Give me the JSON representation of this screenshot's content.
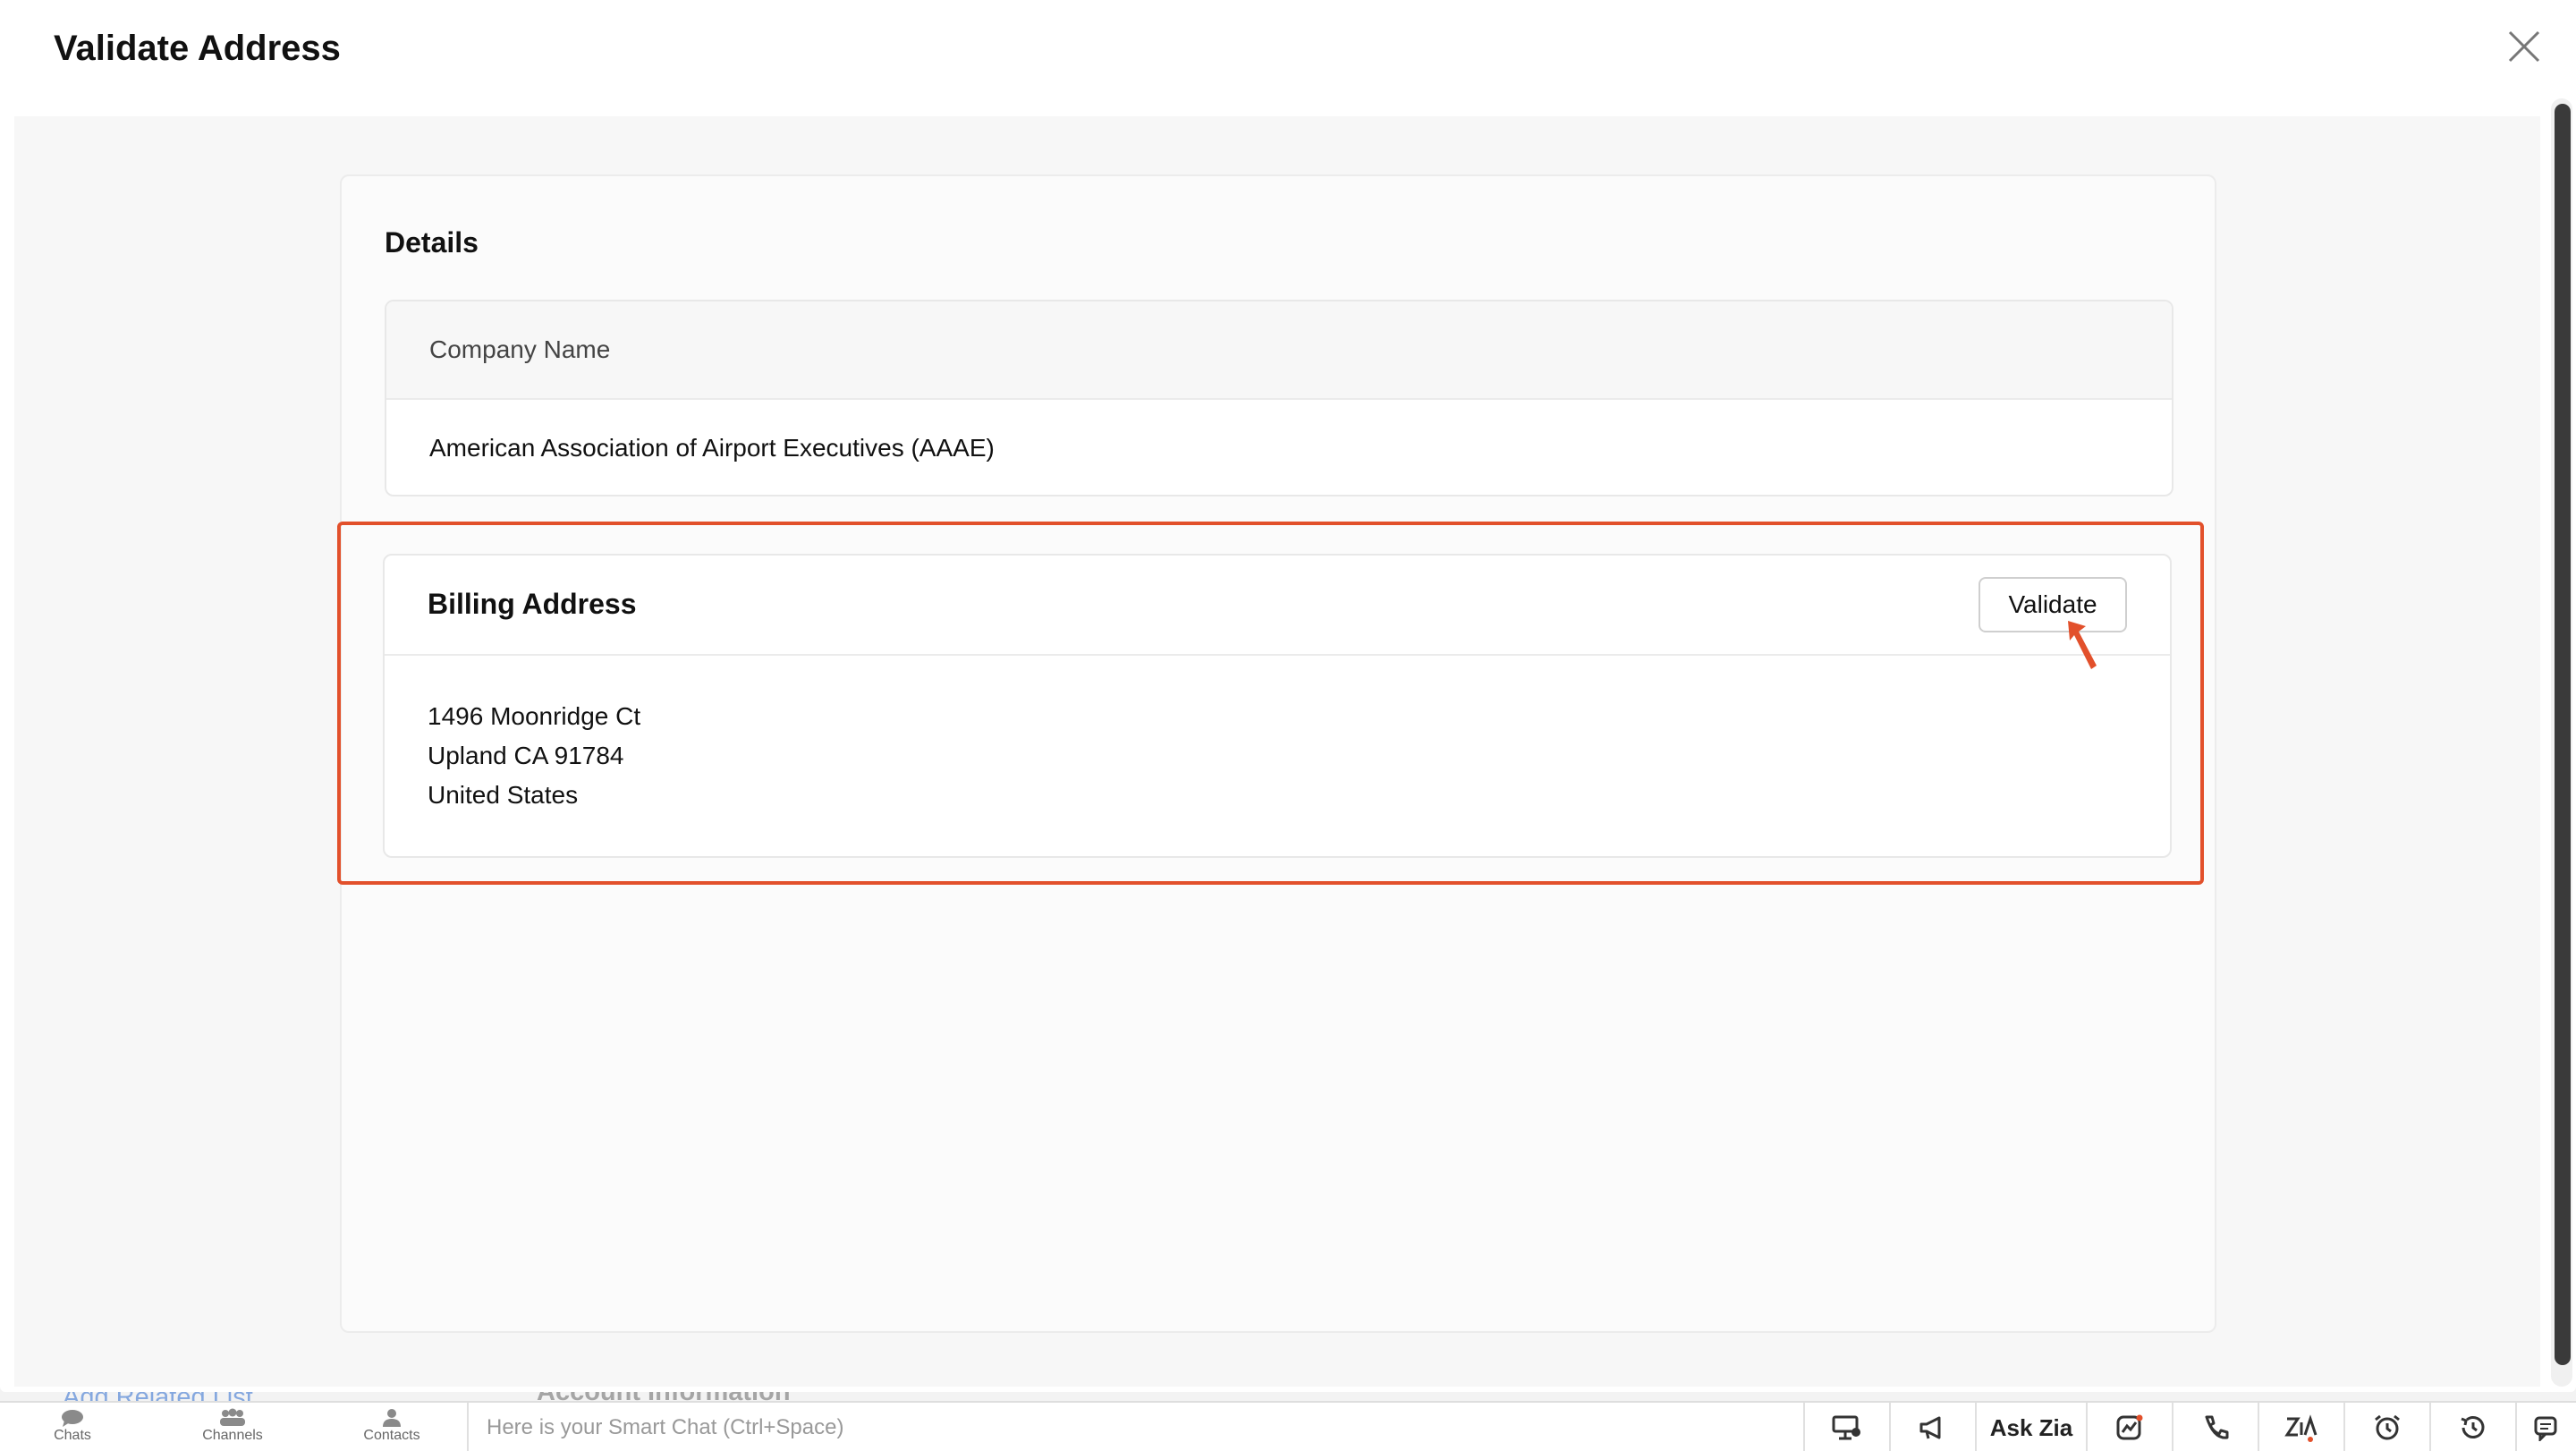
{
  "modal": {
    "title": "Validate Address",
    "close_icon": "close-icon"
  },
  "details": {
    "title": "Details",
    "company_label": "Company Name",
    "company_value": "American Association of Airport Executives (AAAE)"
  },
  "billing": {
    "title": "Billing Address",
    "validate_label": "Validate",
    "address_lines": [
      "1496 Moonridge Ct",
      "Upland CA 91784",
      "United States"
    ],
    "highlight_color": "#e2502b"
  },
  "background": {
    "related_link": "Add Related List",
    "section_title": "Account Information"
  },
  "bottom_bar": {
    "tabs": [
      {
        "label": "Chats",
        "icon": "chat-bubble-icon"
      },
      {
        "label": "Channels",
        "icon": "channels-icon"
      },
      {
        "label": "Contacts",
        "icon": "contact-person-icon"
      }
    ],
    "smart_chat_placeholder": "Here is your Smart Chat (Ctrl+Space)",
    "tools": [
      {
        "name": "screen-share-icon"
      },
      {
        "name": "megaphone-icon"
      },
      {
        "name": "ask-zia-button",
        "label": "Ask Zia"
      },
      {
        "name": "analytics-icon"
      },
      {
        "name": "phone-icon"
      },
      {
        "name": "zia-icon"
      },
      {
        "name": "alarm-clock-icon"
      },
      {
        "name": "history-icon"
      },
      {
        "name": "chat-help-icon"
      }
    ]
  }
}
